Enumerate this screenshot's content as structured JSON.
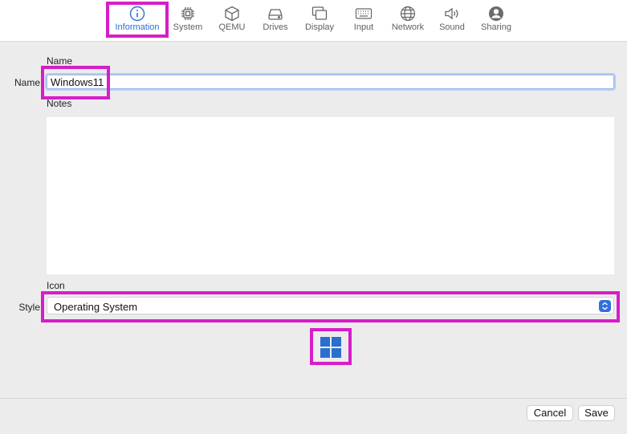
{
  "toolbar": {
    "tabs": [
      {
        "label": "Information",
        "icon": "info-circle-icon"
      },
      {
        "label": "System",
        "icon": "cpu-chip-icon"
      },
      {
        "label": "QEMU",
        "icon": "cube-icon"
      },
      {
        "label": "Drives",
        "icon": "drive-icon"
      },
      {
        "label": "Display",
        "icon": "display-icon"
      },
      {
        "label": "Input",
        "icon": "keyboard-icon"
      },
      {
        "label": "Network",
        "icon": "globe-icon"
      },
      {
        "label": "Sound",
        "icon": "speaker-icon"
      },
      {
        "label": "Sharing",
        "icon": "person-icon"
      }
    ],
    "active_tab": "Information",
    "accent_color": "#2b6fd6",
    "highlight_color": "#d61ec8"
  },
  "name_section": {
    "heading": "Name",
    "field_label": "Name",
    "value": "Windows11"
  },
  "notes_section": {
    "heading": "Notes",
    "value": ""
  },
  "icon_section": {
    "heading": "Icon",
    "style_label": "Style",
    "style_value": "Operating System",
    "selected_icon": "windows-logo-icon"
  },
  "footer": {
    "cancel_label": "Cancel",
    "save_label": "Save"
  }
}
